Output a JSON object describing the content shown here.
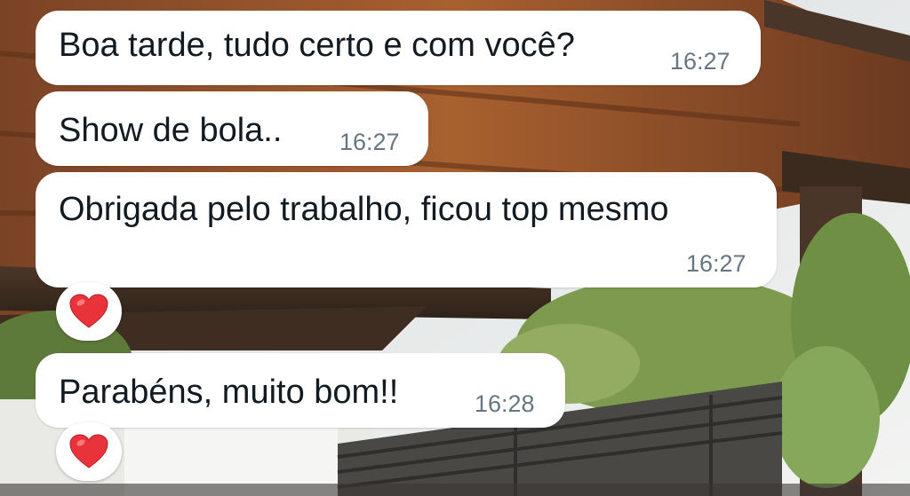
{
  "messages": [
    {
      "text": "Boa tarde, tudo certo e com você?",
      "time": "16:27"
    },
    {
      "text": "Show de bola..",
      "time": "16:27"
    },
    {
      "text": "Obrigada pelo trabalho, ficou top mesmo",
      "time": "16:27",
      "reaction": "heart-emoji"
    },
    {
      "text": "Parabéns, muito bom!!",
      "time": "16:28",
      "reaction": "heart-emoji"
    }
  ],
  "colors": {
    "bubble": "#ffffff",
    "text": "#111b21",
    "time": "#667781",
    "heart": "#e8333a"
  }
}
